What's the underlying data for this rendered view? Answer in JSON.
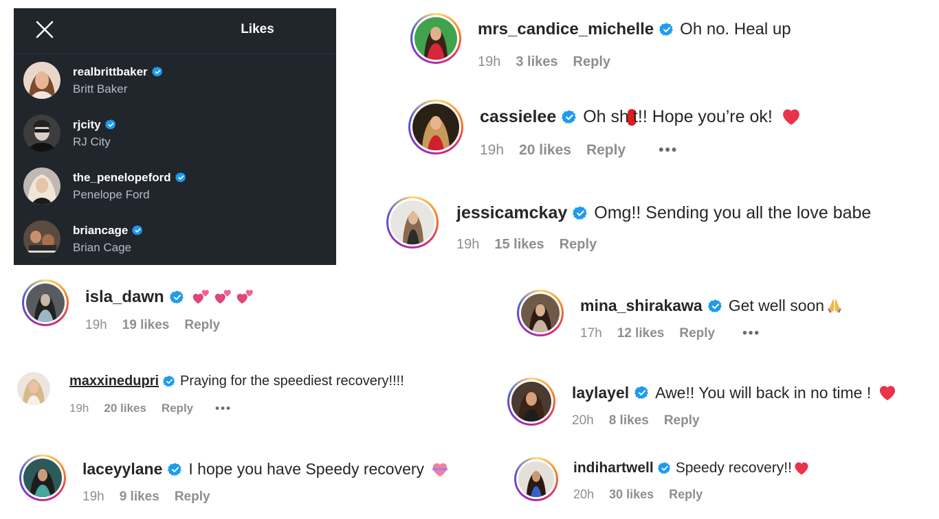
{
  "likes_panel": {
    "title": "Likes",
    "users": [
      {
        "username": "realbrittbaker",
        "name": "Britt Baker"
      },
      {
        "username": "rjcity",
        "name": "RJ City"
      },
      {
        "username": "the_penelopeford",
        "name": "Penelope Ford"
      },
      {
        "username": "briancage",
        "name": "Brian Cage"
      }
    ]
  },
  "comments": [
    {
      "username": "mrs_candice_michelle",
      "text": "Oh no. Heal up",
      "time": "19h",
      "likes": "3 likes",
      "reply": "Reply"
    },
    {
      "username": "cassielee",
      "text": "Oh sh",
      "text_after": "t!! Hope you’re ok!",
      "time": "19h",
      "likes": "20 likes",
      "reply": "Reply",
      "more": "•••"
    },
    {
      "username": "jessicamckay",
      "text": "Omg!! Sending you all the love babe",
      "time": "19h",
      "likes": "15 likes",
      "reply": "Reply"
    },
    {
      "username": "isla_dawn",
      "text": "",
      "time": "19h",
      "likes": "19 likes",
      "reply": "Reply"
    },
    {
      "username": "mina_shirakawa",
      "text": "Get well soon",
      "time": "17h",
      "likes": "12 likes",
      "reply": "Reply",
      "more": "•••"
    },
    {
      "username": "maxxinedupri",
      "text": "Praying for the speediest recovery!!!!",
      "time": "19h",
      "likes": "20 likes",
      "reply": "Reply",
      "more": "•••"
    },
    {
      "username": "laylayel",
      "text": "Awe!! You will back in no time !",
      "time": "20h",
      "likes": "8 likes",
      "reply": "Reply"
    },
    {
      "username": "laceyylane",
      "text": "I hope you have Speedy recovery",
      "time": "19h",
      "likes": "9 likes",
      "reply": "Reply"
    },
    {
      "username": "indihartwell",
      "text": "Speedy recovery!!",
      "time": "20h",
      "likes": "30 likes",
      "reply": "Reply"
    }
  ],
  "icons": {
    "close": "close-icon",
    "verified": "verified-badge-icon",
    "heart": "red-heart-icon",
    "two_hearts": "two-hearts-icon",
    "praying_hands": "praying-hands-icon",
    "heart_ribbon": "heart-with-ribbon-icon"
  },
  "colors": {
    "panel_bg": "#21252c",
    "verified": "#1d9bf0",
    "meta": "#8e8e8e",
    "heart": "#e8334a"
  }
}
